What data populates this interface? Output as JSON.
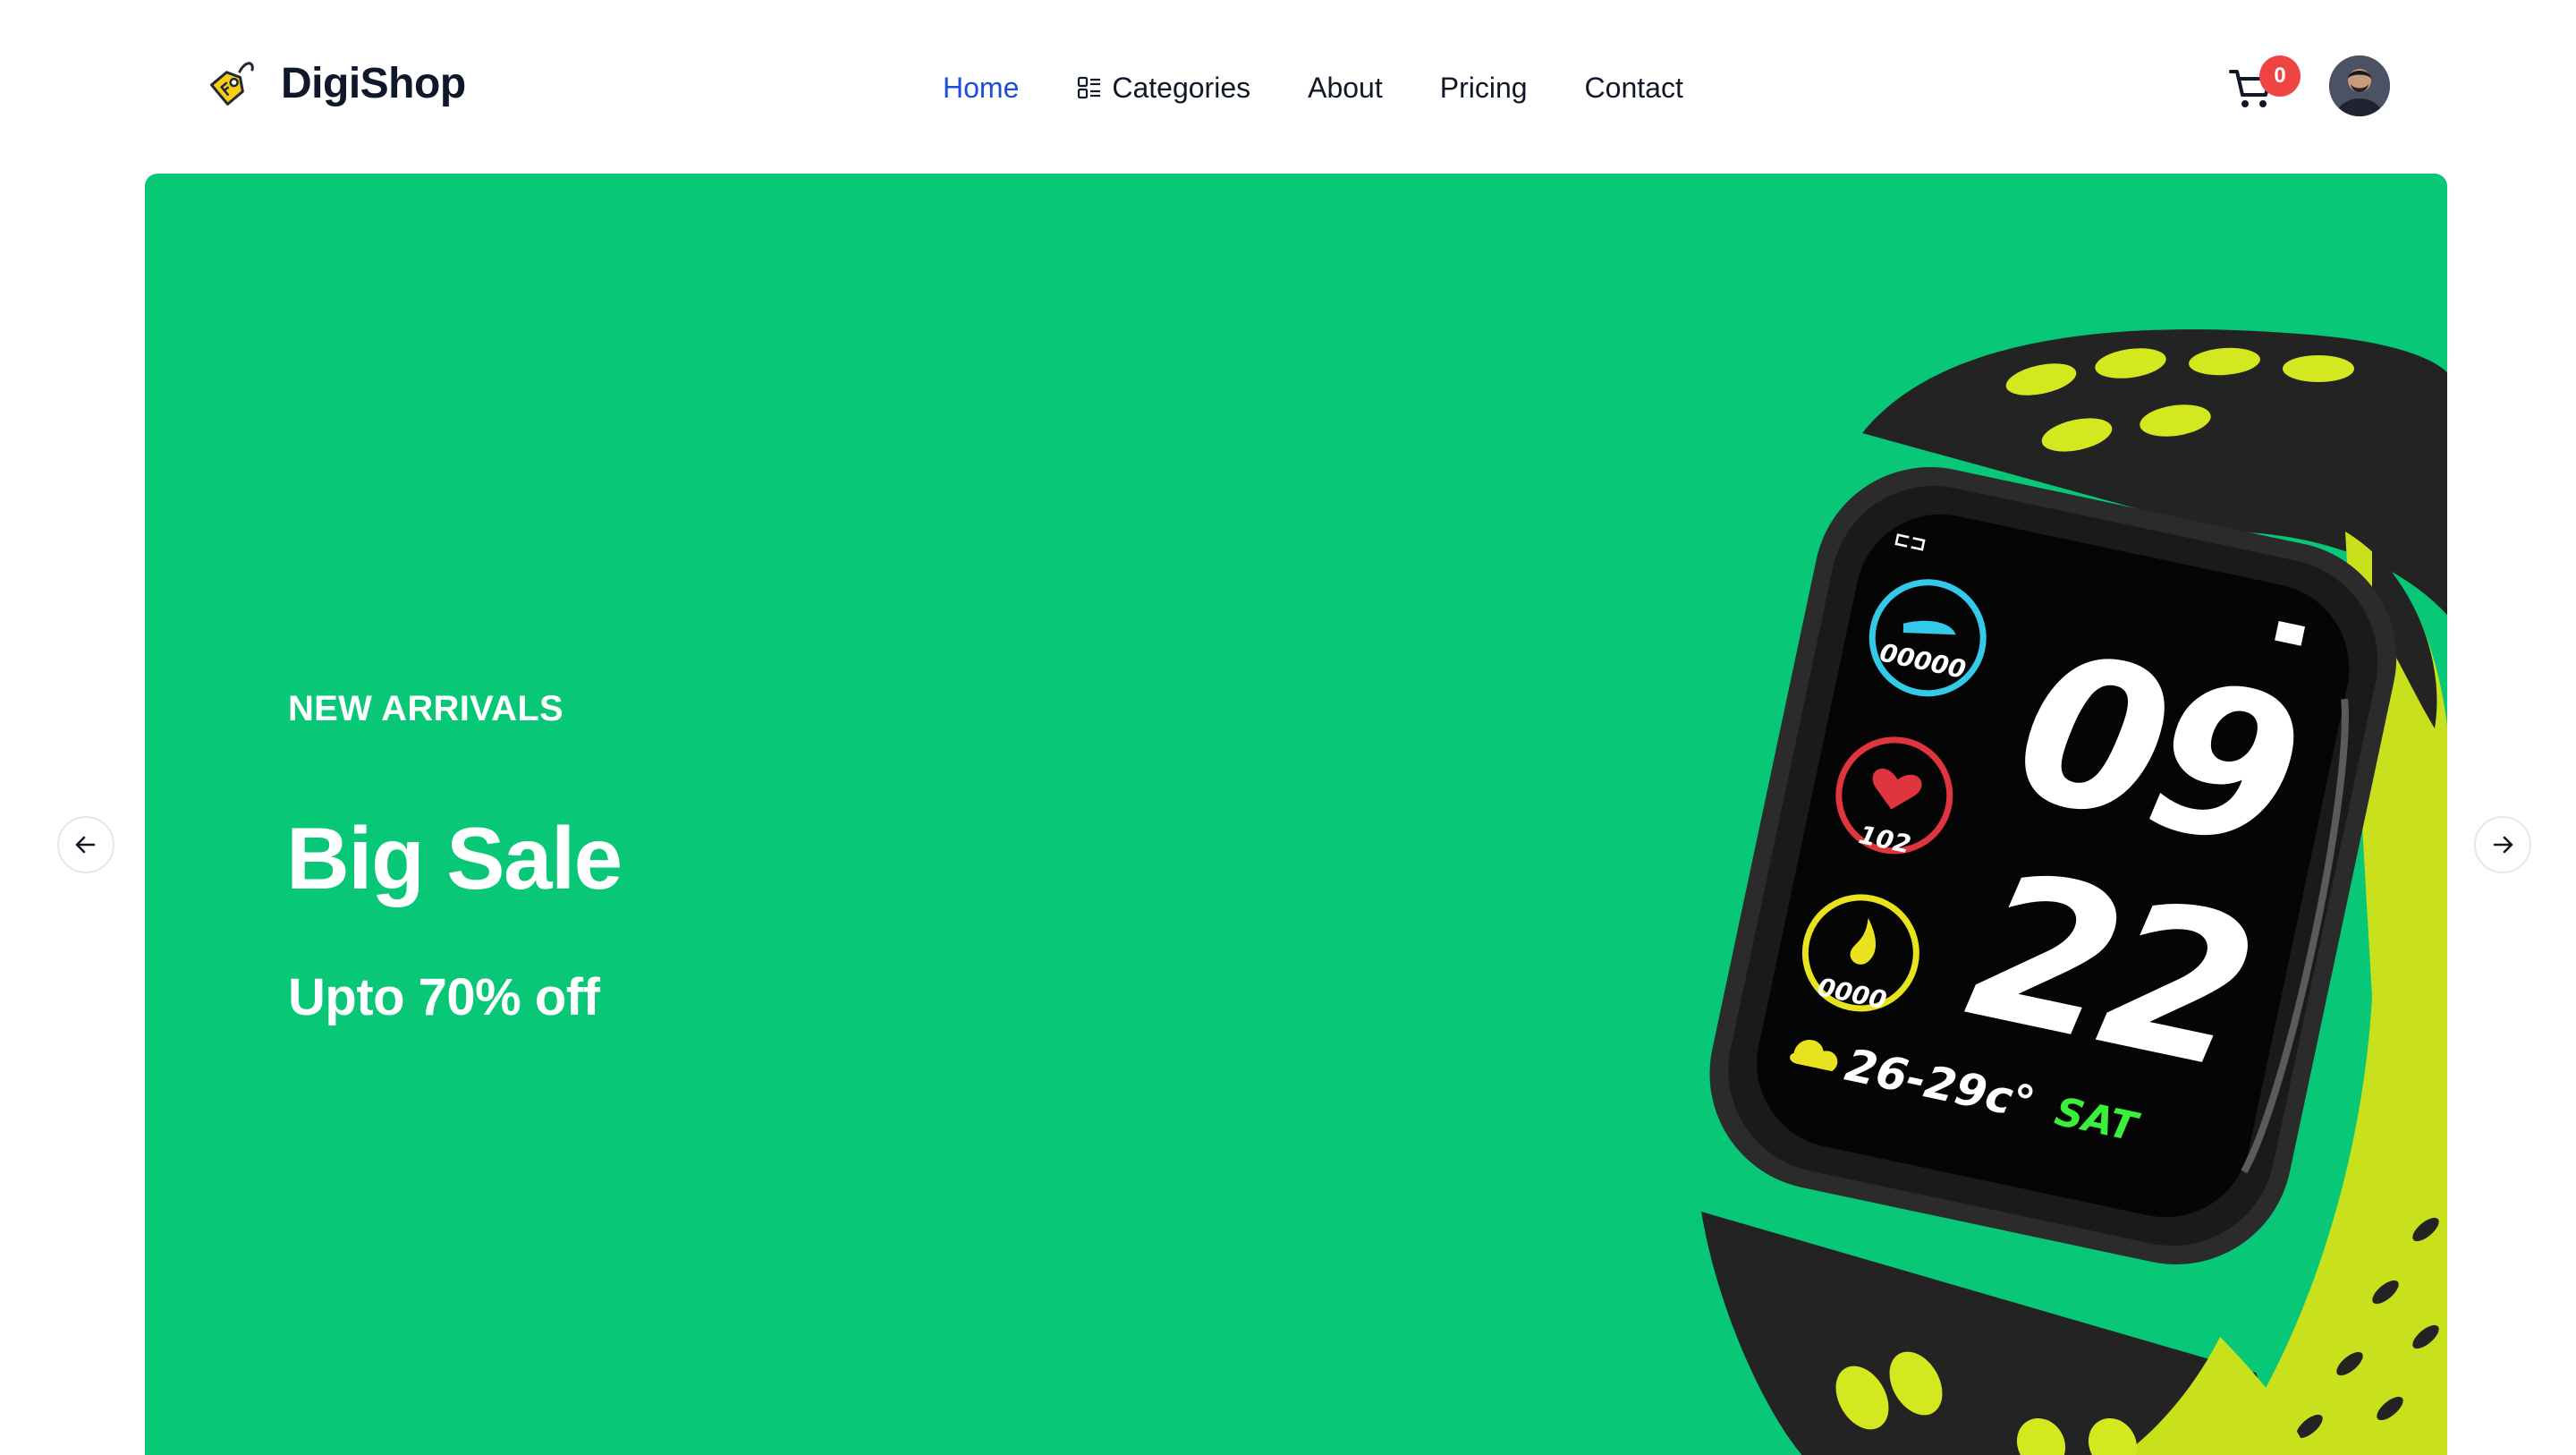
{
  "brand": {
    "name": "DigiShop",
    "logo_icon": "price-tag-icon",
    "logo_color": "#facc15"
  },
  "nav": {
    "items": [
      {
        "label": "Home",
        "active": true
      },
      {
        "label": "Categories",
        "icon": "grid-list-icon"
      },
      {
        "label": "About"
      },
      {
        "label": "Pricing"
      },
      {
        "label": "Contact"
      }
    ],
    "active_color": "#1d4ed8"
  },
  "cart": {
    "icon": "shopping-cart-icon",
    "count": "0",
    "badge_color": "#ef4444"
  },
  "user": {
    "avatar_icon": "user-avatar"
  },
  "hero": {
    "kicker": "NEW ARRIVALS",
    "title": "Big Sale",
    "subtitle": "Upto 70% off",
    "background": "#08c777",
    "image": {
      "icon": "smartwatch-image",
      "time_hours": "09",
      "time_minutes": "22",
      "steps": "00000",
      "heart_rate": "102",
      "calories": "0000",
      "temperature": "26-29c°",
      "day": "SAT"
    }
  },
  "carousel": {
    "prev_icon": "arrow-left-icon",
    "next_icon": "arrow-right-icon"
  }
}
